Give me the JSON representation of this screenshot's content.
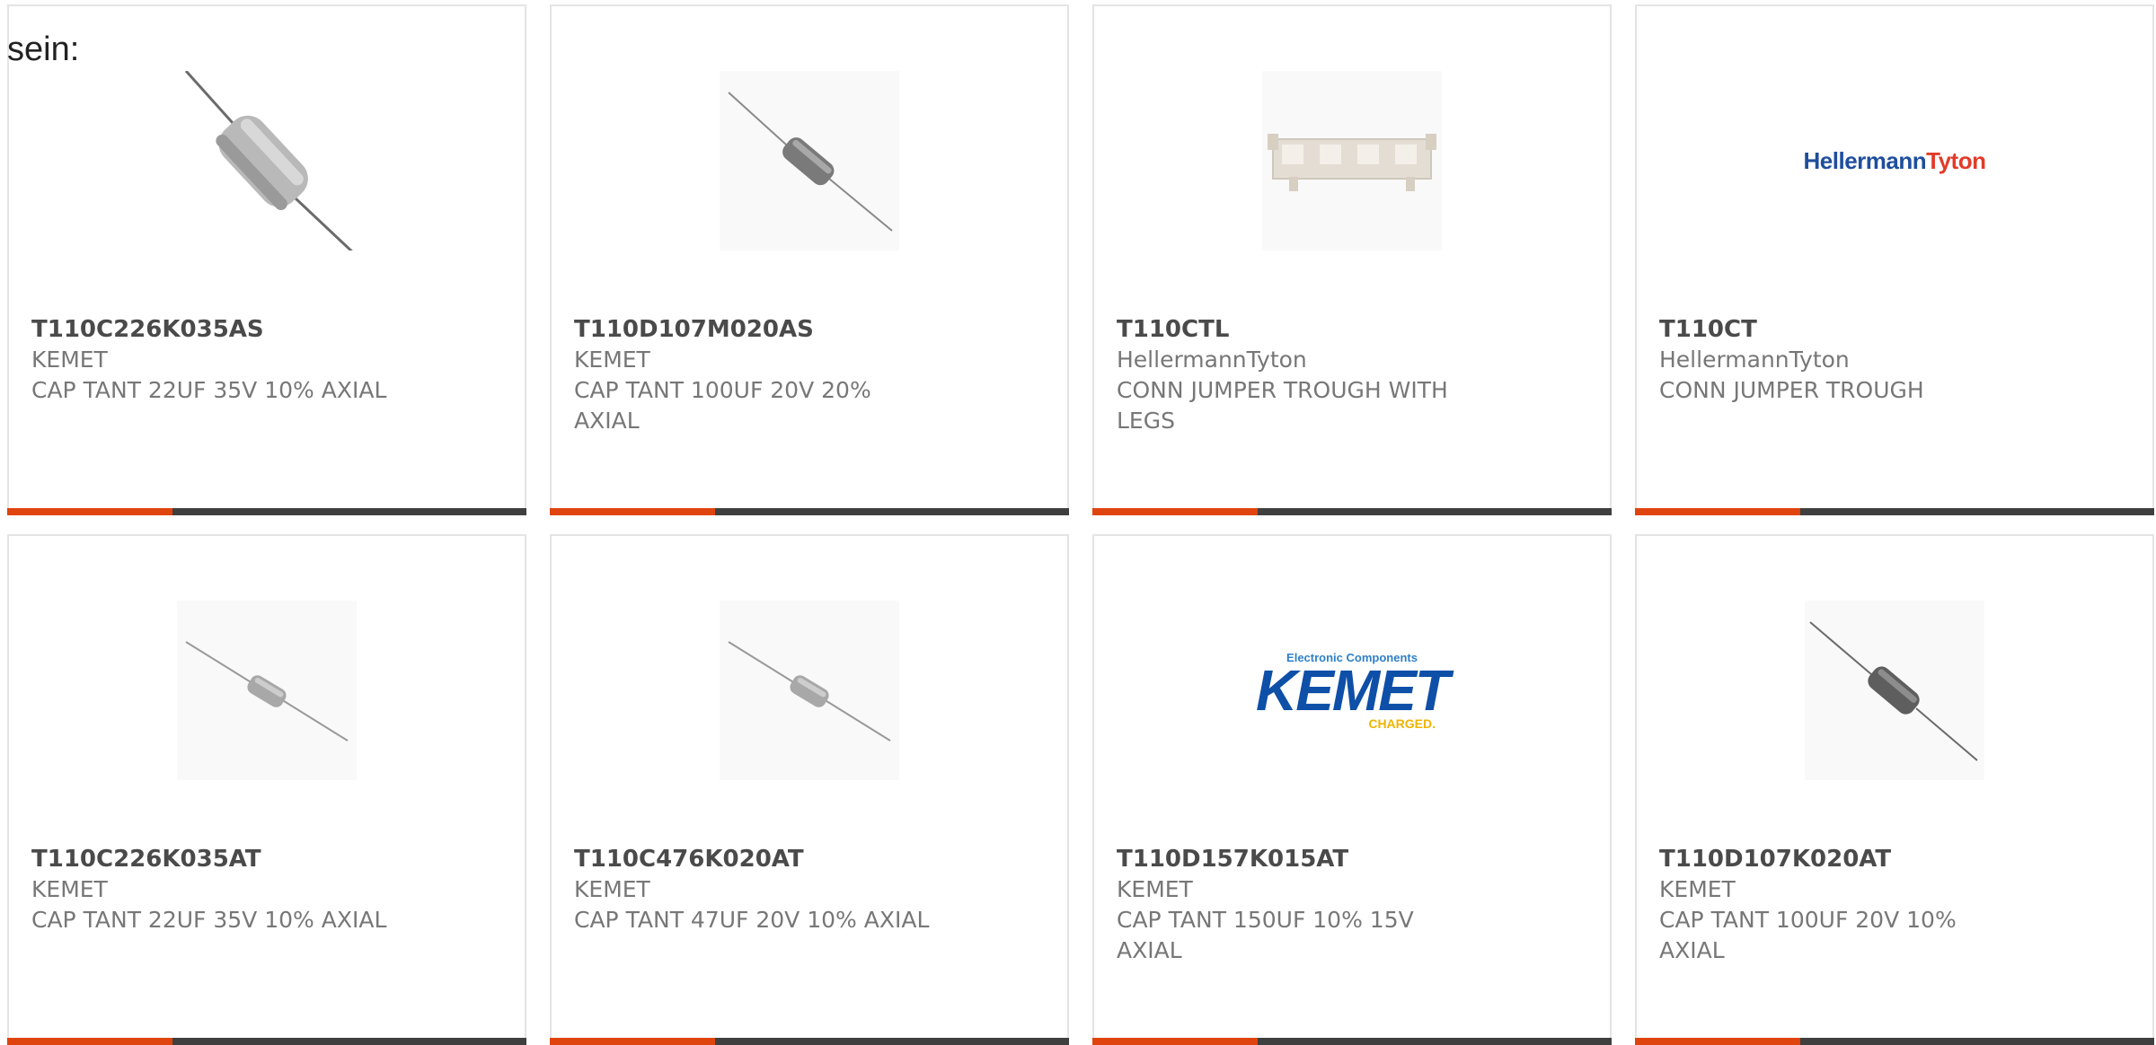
{
  "intro_text": "sein:",
  "colors": {
    "accent": "#e0440e",
    "bar": "#3f3f3f",
    "border": "#e4e4e4"
  },
  "cards": [
    {
      "part": "T110C226K035AS",
      "maker": "KEMET",
      "desc": "CAP TANT 22UF 35V 10% AXIAL",
      "image": "capacitor-large-photo"
    },
    {
      "part": "T110D107M020AS",
      "maker": "KEMET",
      "desc": "CAP TANT 100UF 20V 20% AXIAL",
      "image": "capacitor-photo"
    },
    {
      "part": "T110CTL",
      "maker": "HellermannTyton",
      "desc": "CONN JUMPER TROUGH WITH LEGS",
      "image": "jumper-trough-photo"
    },
    {
      "part": "T110CT",
      "maker": "HellermannTyton",
      "desc": "CONN JUMPER TROUGH",
      "image": "hellermanntyton-logo",
      "logo": {
        "part1": "Hellermann",
        "part2": "Tyton"
      }
    },
    {
      "part": "T110C226K035AT",
      "maker": "KEMET",
      "desc": "CAP TANT 22UF 35V 10% AXIAL",
      "image": "capacitor-small-photo"
    },
    {
      "part": "T110C476K020AT",
      "maker": "KEMET",
      "desc": "CAP TANT 47UF 20V 10% AXIAL",
      "image": "capacitor-small-photo"
    },
    {
      "part": "T110D157K015AT",
      "maker": "KEMET",
      "desc": "CAP TANT 150UF 10% 15V AXIAL",
      "image": "kemet-logo",
      "logo": {
        "top": "Electronic Components",
        "main": "KEMET",
        "sub": "CHARGED."
      }
    },
    {
      "part": "T110D107K020AT",
      "maker": "KEMET",
      "desc": "CAP TANT 100UF 20V 10% AXIAL",
      "image": "capacitor-photo"
    }
  ]
}
